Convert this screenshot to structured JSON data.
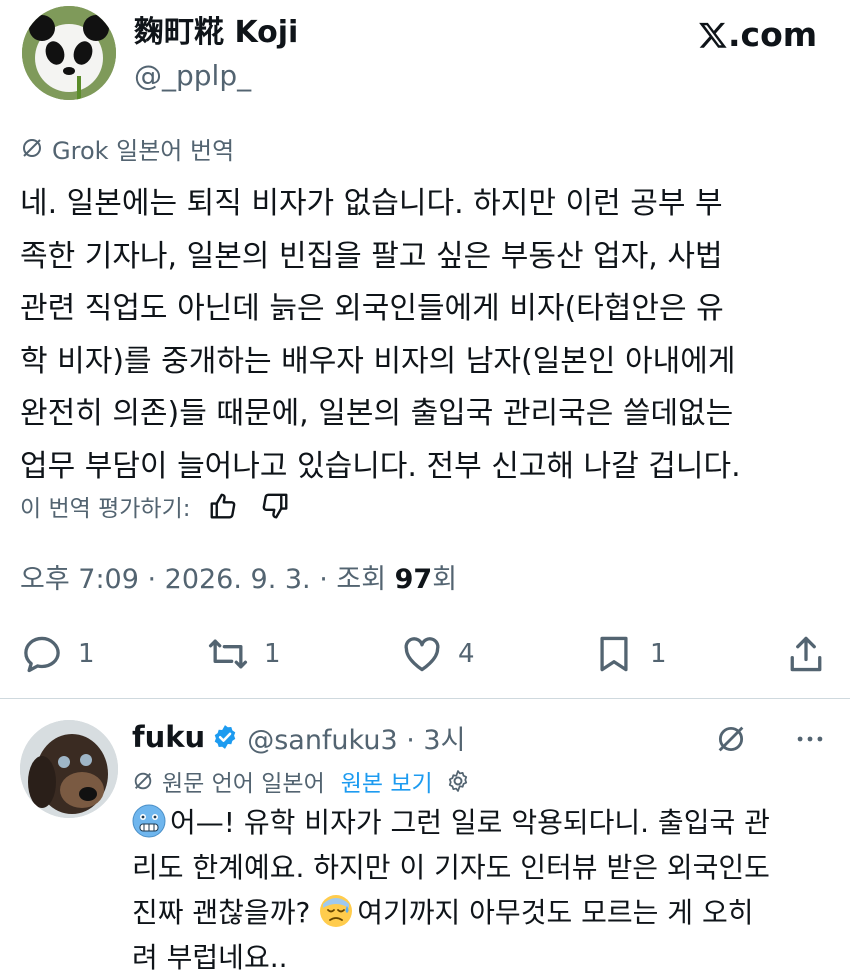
{
  "header": {
    "display_name": "麴町糀 Koji",
    "handle": "@_pplp_",
    "site_label": ".com",
    "site_logo": "x-logo-icon"
  },
  "translation": {
    "label": "Grok 일본어 번역",
    "icon": "translate-slash-icon"
  },
  "tweet": {
    "text": "네. 일본에는 퇴직 비자가 없습니다. 하지만 이런 공부 부\n족한 기자나, 일본의 빈집을 팔고 싶은 부동산 업자, 사법\n관련 직업도 아닌데 늙은 외국인들에게 비자(타협안은 유\n학 비자)를 중개하는 배우자 비자의 남자(일본인 아내에게\n완전히 의존)들 때문에, 일본의 출입국 관리국은 쓸데없는\n업무 부담이 늘어나고 있습니다. 전부 신고해 나갈 겁니다."
  },
  "rating": {
    "label": "이 번역 평가하기:"
  },
  "meta": {
    "time_date": "오후 7:09 · 2026. 9. 3. · 조회 ",
    "views": "97",
    "views_suffix": "회"
  },
  "actions": {
    "reply_count": "1",
    "retweet_count": "1",
    "like_count": "4",
    "bookmark_count": "1"
  },
  "reply": {
    "name": "fuku",
    "handle": "@sanfuku3 · 3시",
    "source_label": "원문 언어 일본어",
    "view_original": "원본 보기",
    "line1_text": "어—! 유학 비자가 그런 일로 악용되다니. 출입국 관\n리도 한계예요. 하지만 이 기자도 인터뷰 받은 외국인도\n진짜 괜찮을까? ",
    "line2_text": "여기까지 아무것도 모르는 게 오히\n려 부럽네요..",
    "emoji1": "cold-face-emoji",
    "emoji2": "anxious-sweat-emoji"
  },
  "colors": {
    "text": "#0f1419",
    "secondary": "#536471",
    "link": "#1d9bf0",
    "verified": "#1d9bf0",
    "divider": "#cfd9de"
  }
}
